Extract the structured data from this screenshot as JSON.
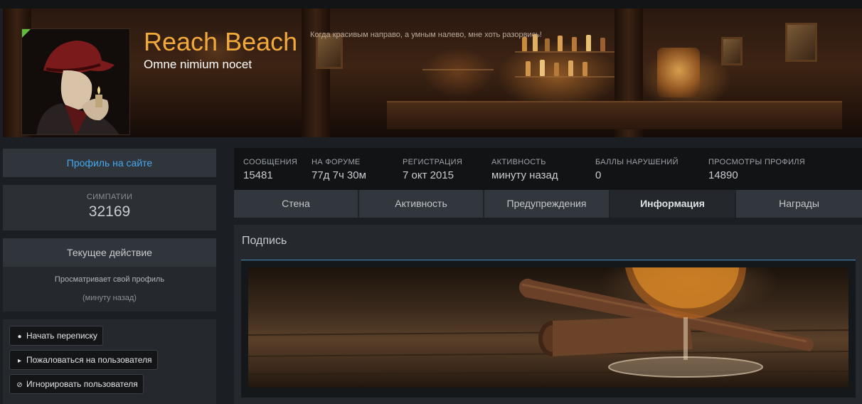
{
  "header": {
    "username": "Reach Beach",
    "user_title": "Omne nimium nocet",
    "status": "Когда красивым направо, а умным налево, мне хоть разорвись!"
  },
  "sidebar": {
    "profile_link": "Профиль на сайте",
    "likes": {
      "label": "СИМПАТИИ",
      "value": "32169"
    },
    "current_activity": {
      "heading": "Текущее действие",
      "text": "Просматривает свой профиль",
      "time": "(минуту назад)"
    },
    "actions": [
      {
        "label": "Начать переписку",
        "icon": "chat-icon"
      },
      {
        "label": "Пожаловаться на пользователя",
        "icon": "megaphone-icon"
      },
      {
        "label": "Игнорировать пользователя",
        "icon": "ban-icon"
      }
    ]
  },
  "stats": [
    {
      "label": "СООБЩЕНИЯ",
      "value": "15481"
    },
    {
      "label": "НА ФОРУМЕ",
      "value": "77д 7ч 30м"
    },
    {
      "label": "РЕГИСТРАЦИЯ",
      "value": "7 окт 2015"
    },
    {
      "label": "АКТИВНОСТЬ",
      "value": "минуту назад"
    },
    {
      "label": "БАЛЛЫ НАРУШЕНИЙ",
      "value": "0"
    },
    {
      "label": "ПРОСМОТРЫ ПРОФИЛЯ",
      "value": "14890"
    }
  ],
  "tabs": [
    {
      "label": "Стена",
      "active": false
    },
    {
      "label": "Активность",
      "active": false
    },
    {
      "label": "Предупреждения",
      "active": false
    },
    {
      "label": "Информация",
      "active": true
    },
    {
      "label": "Награды",
      "active": false
    }
  ],
  "content": {
    "section_title": "Подпись"
  },
  "colors": {
    "accent_link": "#47a7eb",
    "username": "#f0a93a",
    "rule": "#3a86b0",
    "online_corner": "#5fbf3a"
  }
}
